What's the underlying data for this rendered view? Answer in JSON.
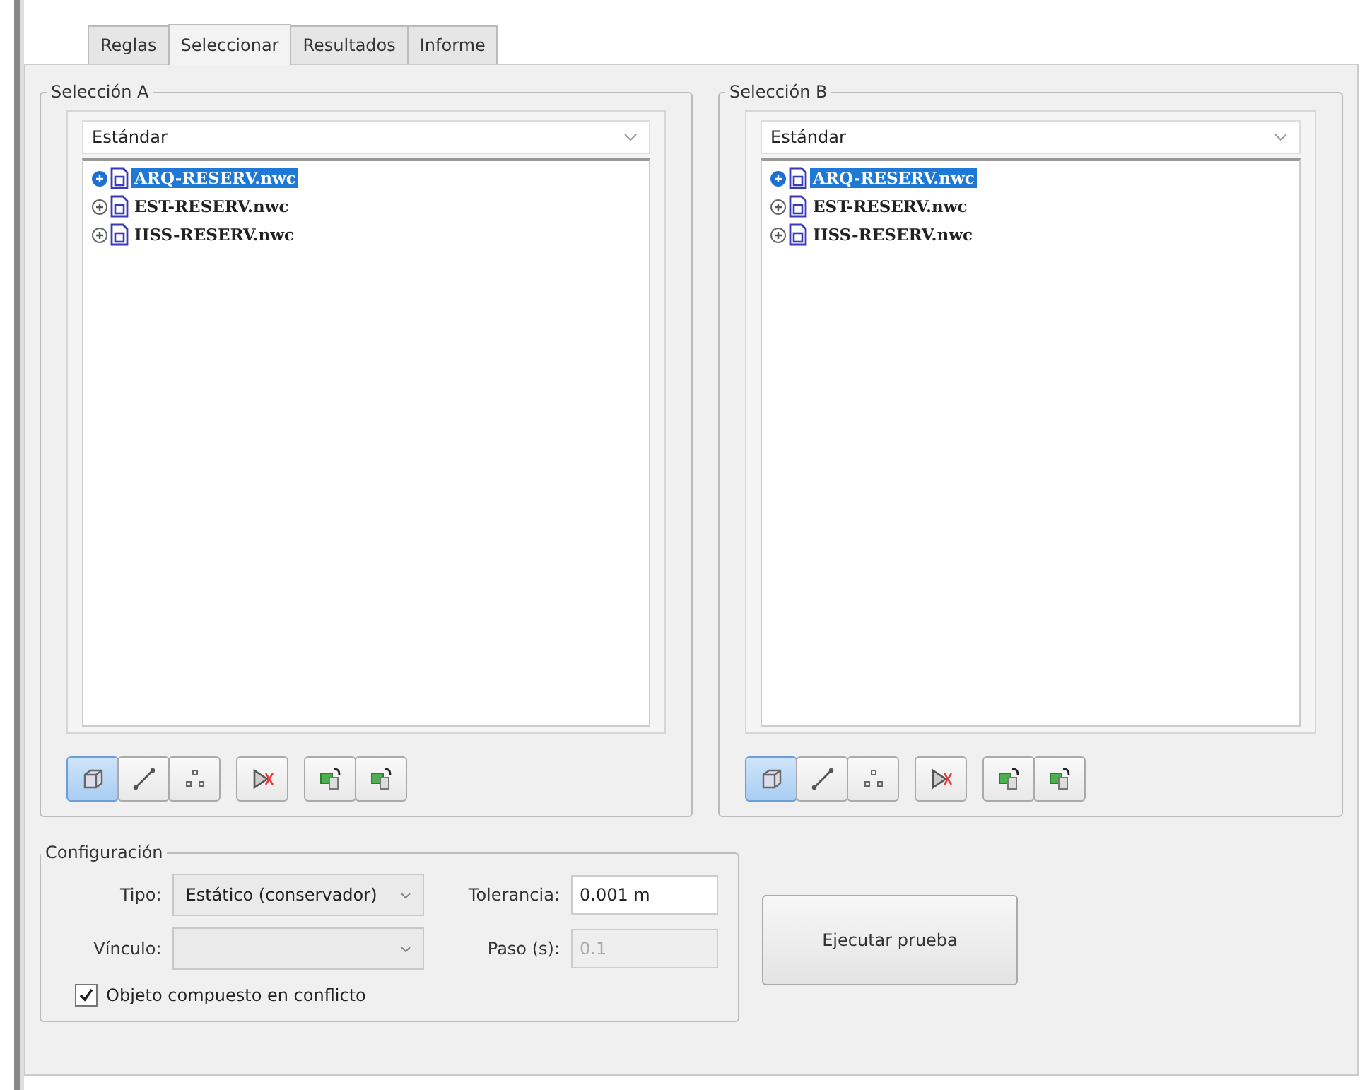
{
  "tabs": [
    {
      "label": "Reglas",
      "selected": false
    },
    {
      "label": "Seleccionar",
      "selected": true
    },
    {
      "label": "Resultados",
      "selected": false
    },
    {
      "label": "Informe",
      "selected": false
    }
  ],
  "selections": [
    {
      "title": "Selección A",
      "dropdown": "Estándar",
      "tree": [
        {
          "label": "ARQ-RESERV.nwc",
          "selected": true
        },
        {
          "label": "EST-RESERV.nwc",
          "selected": false
        },
        {
          "label": "IISS-RESERV.nwc",
          "selected": false
        }
      ],
      "tools": [
        {
          "kind": "solid",
          "selected": true
        },
        {
          "kind": "line",
          "selected": false
        },
        {
          "kind": "points",
          "selected": false
        },
        {
          "kind": "clear",
          "selected": false
        },
        {
          "kind": "save",
          "selected": false
        },
        {
          "kind": "load",
          "selected": false
        }
      ]
    },
    {
      "title": "Selección B",
      "dropdown": "Estándar",
      "tree": [
        {
          "label": "ARQ-RESERV.nwc",
          "selected": true
        },
        {
          "label": "EST-RESERV.nwc",
          "selected": false
        },
        {
          "label": "IISS-RESERV.nwc",
          "selected": false
        }
      ],
      "tools": [
        {
          "kind": "solid",
          "selected": true
        },
        {
          "kind": "line",
          "selected": false
        },
        {
          "kind": "points",
          "selected": false
        },
        {
          "kind": "clear",
          "selected": false
        },
        {
          "kind": "save",
          "selected": false
        },
        {
          "kind": "load",
          "selected": false
        }
      ]
    }
  ],
  "configuration": {
    "title": "Configuración",
    "type": {
      "label": "Tipo:",
      "value": "Estático (conservador)"
    },
    "tolerance": {
      "label": "Tolerancia:",
      "value": "0.001 m"
    },
    "link": {
      "label": "Vínculo:"
    },
    "step": {
      "label": "Paso (s):",
      "value": "0.1",
      "disabled": true
    },
    "composite": {
      "label": "Objeto compuesto en conflicto",
      "checked": true
    }
  },
  "run_button": "Ejecutar prueba"
}
